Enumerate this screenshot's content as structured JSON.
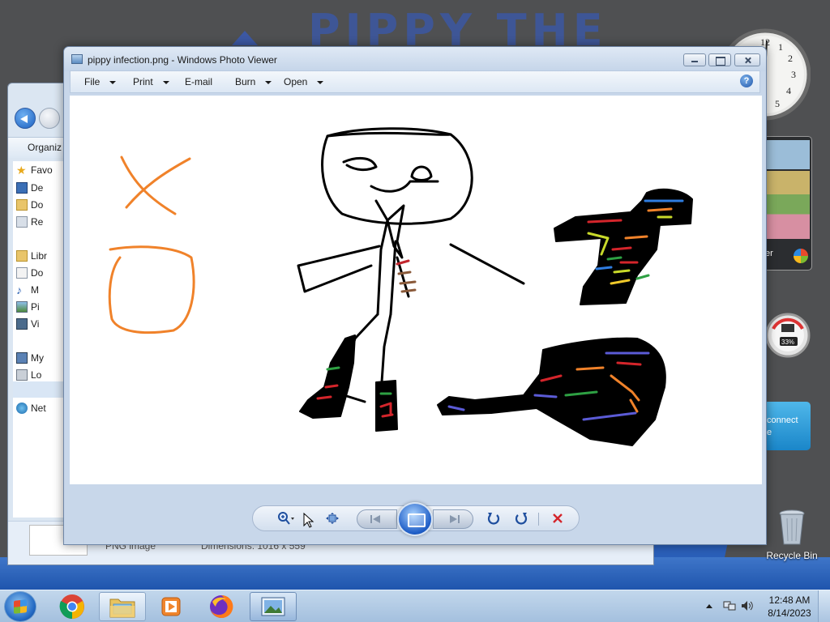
{
  "desktop": {
    "background_text": "PIPPY THE",
    "gadgets": {
      "clock_numbers": [
        "12",
        "1",
        "2",
        "3",
        "4",
        "5"
      ],
      "slideshow_label": "er",
      "cpu_percent": "33%",
      "connect_label_1": "connect",
      "connect_label_2": "e"
    },
    "recycle_bin_label": "Recycle Bin"
  },
  "explorer": {
    "toolbar_label": "Organiz",
    "sidebar": [
      {
        "icon": "star-icon",
        "label": "Favo"
      },
      {
        "icon": "desktop-icon",
        "label": "De"
      },
      {
        "icon": "downloads-icon",
        "label": "Do"
      },
      {
        "icon": "recent-icon",
        "label": "Re"
      },
      {
        "icon": "library-icon",
        "label": "Libr"
      },
      {
        "icon": "documents-icon",
        "label": "Do"
      },
      {
        "icon": "music-icon",
        "label": "M"
      },
      {
        "icon": "pictures-icon",
        "label": "Pi"
      },
      {
        "icon": "videos-icon",
        "label": "Vi"
      },
      {
        "icon": "computer-icon",
        "label": "My"
      },
      {
        "icon": "local-disk-icon",
        "label": "Lo"
      },
      {
        "icon": "network-icon",
        "label": "Net"
      }
    ],
    "status": {
      "file_type": "PNG image",
      "dimensions": "Dimensions: 1016 x 559"
    }
  },
  "viewer": {
    "title": "pippy infection.png - Windows Photo Viewer",
    "menu": [
      {
        "label": "File",
        "has_caret": true
      },
      {
        "label": "Print",
        "has_caret": true
      },
      {
        "label": "E-mail",
        "has_caret": false
      },
      {
        "label": "Burn",
        "has_caret": true
      },
      {
        "label": "Open",
        "has_caret": true
      }
    ],
    "help_glyph": "?",
    "controls": [
      "zoom",
      "actual-size",
      "previous",
      "slideshow",
      "next",
      "rotate-counterclockwise",
      "rotate-clockwise",
      "delete"
    ]
  },
  "taskbar": {
    "apps": [
      "chrome",
      "explorer",
      "media-player",
      "firefox",
      "photo-viewer"
    ],
    "time": "12:48 AM",
    "date": "8/14/2023"
  },
  "colors": {
    "accent": "#1d5cc6",
    "delete_red": "#d4252b",
    "drawing_orange": "#f0822a"
  }
}
